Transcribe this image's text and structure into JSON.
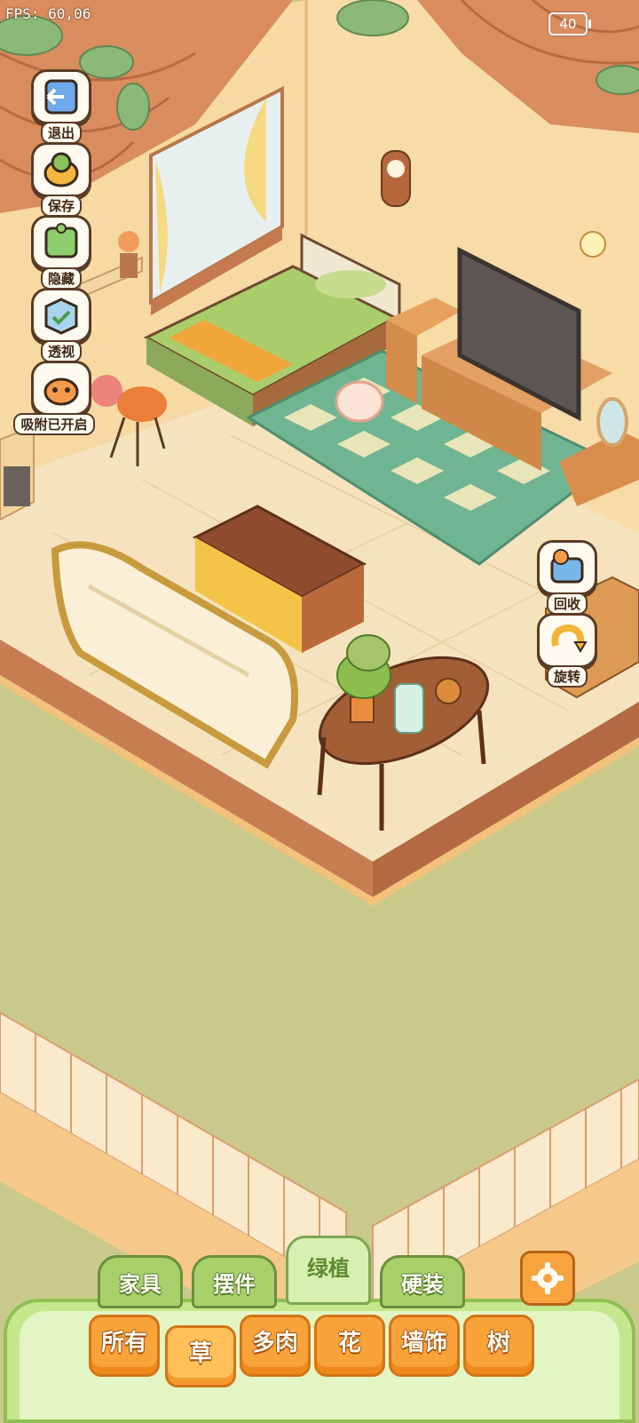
{
  "status": {
    "fps_text": "FPS: 60,06",
    "battery": "40"
  },
  "tools": [
    {
      "label": "退出",
      "icon": "exit-door-icon"
    },
    {
      "label": "保存",
      "icon": "save-duck-icon"
    },
    {
      "label": "隐藏",
      "icon": "hide-puzzle-icon"
    },
    {
      "label": "透视",
      "icon": "perspective-cube-icon"
    },
    {
      "label": "吸附已开启",
      "icon": "snap-fox-icon"
    }
  ],
  "right_tools": [
    {
      "label": "回收",
      "icon": "recycle-icon"
    },
    {
      "label": "旋转",
      "icon": "rotate-icon"
    }
  ],
  "tabs": [
    {
      "label": "家具",
      "active": false
    },
    {
      "label": "摆件",
      "active": false
    },
    {
      "label": "绿植",
      "active": true
    },
    {
      "label": "硬装",
      "active": false
    }
  ],
  "categories": [
    {
      "label": "所有",
      "active": false
    },
    {
      "label": "草",
      "active": true
    },
    {
      "label": "多肉",
      "active": false
    },
    {
      "label": "花",
      "active": false
    },
    {
      "label": "墙饰",
      "active": false
    },
    {
      "label": "树",
      "active": false
    }
  ],
  "colors": {
    "grass": "#c9c98c",
    "wall": "#f6d9a3",
    "floor": "#f5e3bd",
    "rug_green": "#6fb592",
    "tab_green": "#a7d06b",
    "button_orange": "#f8a23a"
  }
}
